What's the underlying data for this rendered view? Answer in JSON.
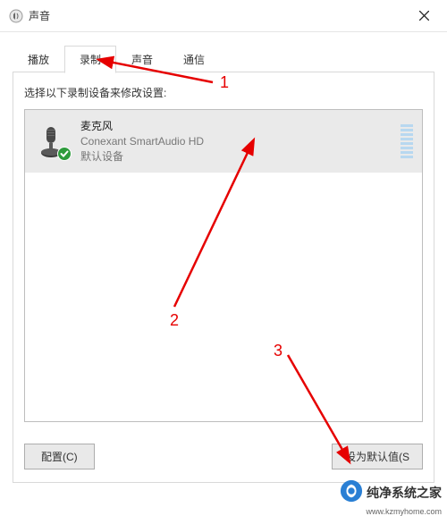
{
  "window": {
    "title": "声音"
  },
  "tabs": [
    {
      "label": "播放"
    },
    {
      "label": "录制"
    },
    {
      "label": "声音"
    },
    {
      "label": "通信"
    }
  ],
  "active_tab_index": 1,
  "panel": {
    "instruction": "选择以下录制设备来修改设置:",
    "devices": [
      {
        "name": "麦克风",
        "sub": "Conexant SmartAudio HD",
        "status": "默认设备"
      }
    ],
    "configure_btn": "配置(C)",
    "set_default_btn": "设为默认值(S"
  },
  "annotations": {
    "one": "1",
    "two": "2",
    "three": "3"
  },
  "watermark": {
    "cn": "纯净系统之家",
    "url": "www.kzmyhome.com"
  }
}
